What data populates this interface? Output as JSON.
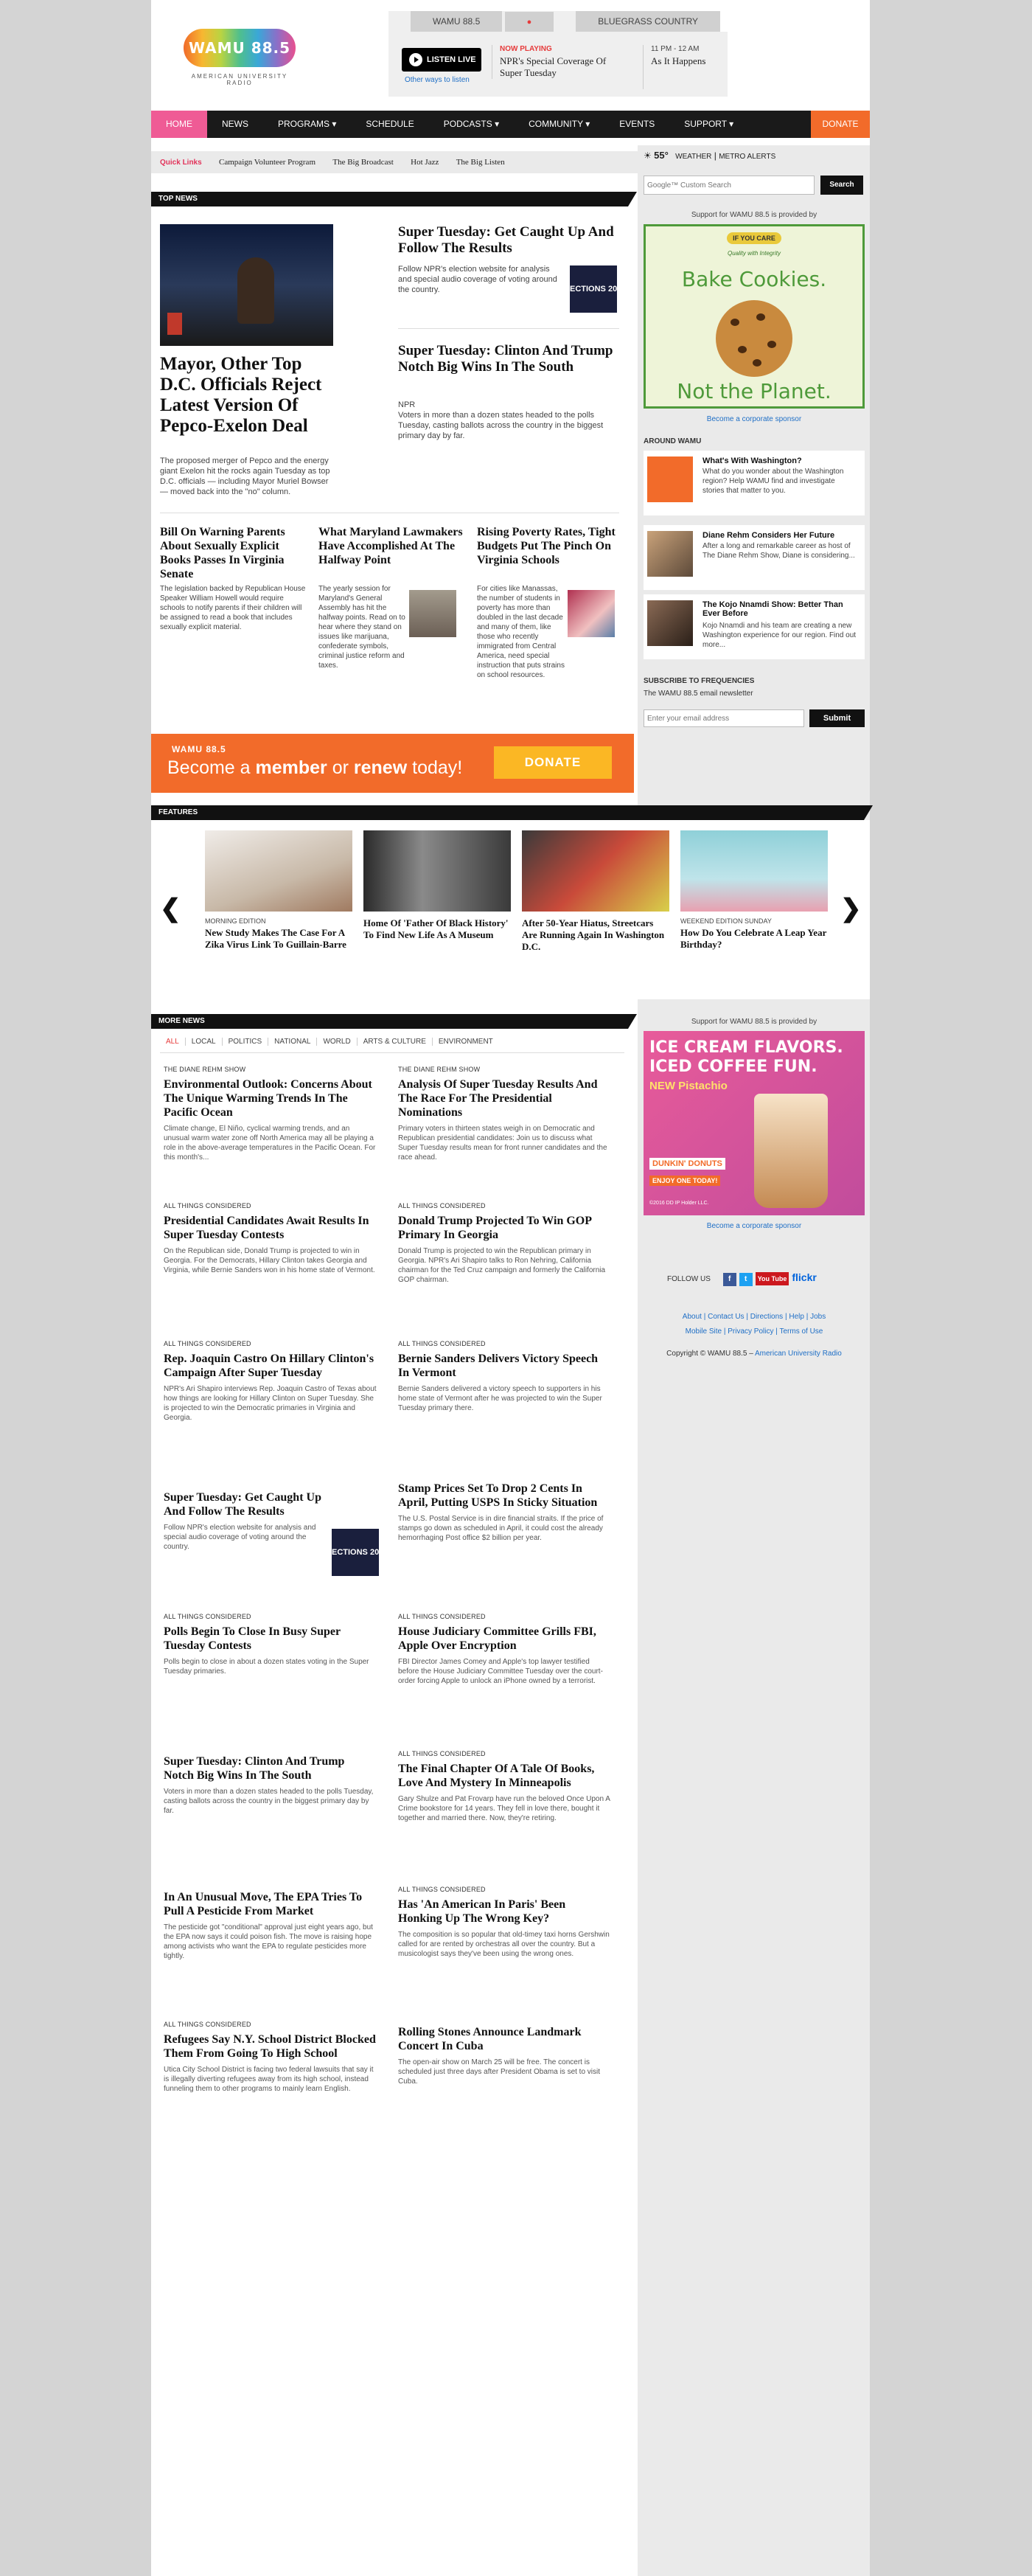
{
  "header": {
    "logo_text": "WAMU 88.5",
    "logo_sub": "AMERICAN UNIVERSITY RADIO",
    "tabs": [
      {
        "label": "WAMU 88.5",
        "dot": "●"
      },
      {
        "label": "BLUEGRASS COUNTRY"
      }
    ],
    "listen_label": "LISTEN LIVE",
    "other_ways": "Other ways to listen",
    "now_playing_label": "NOW PLAYING",
    "now_playing_title": "NPR's Special Coverage Of Super Tuesday",
    "next_time": "11 PM - 12 AM",
    "next_title": "As It Happens"
  },
  "nav": [
    "HOME",
    "NEWS",
    "PROGRAMS ▾",
    "SCHEDULE",
    "PODCASTS ▾",
    "COMMUNITY ▾",
    "EVENTS",
    "SUPPORT ▾",
    "DONATE"
  ],
  "quick_links": {
    "label": "Quick Links",
    "items": [
      "Campaign Volunteer Program",
      "The Big Broadcast",
      "Hot Jazz",
      "The Big Listen"
    ]
  },
  "weather": {
    "temp": "55°",
    "weather_label": "WEATHER",
    "metro_label": "METRO ALERTS",
    "search_placeholder": "Google™ Custom Search",
    "search_button": "Search"
  },
  "support_text": "Support for WAMU 88.5 is provided by",
  "ad1": {
    "top": "IF YOU CARE",
    "sub": "Quality with Integrity",
    "line1": "Bake Cookies.",
    "line2": "Not the Planet."
  },
  "corporate_sponsor": "Become a corporate sponsor",
  "around": {
    "header": "AROUND WAMU",
    "items": [
      {
        "title": "What's With Washington?",
        "desc": "What do you wonder about the Washington region? Help WAMU find and investigate stories that matter to you."
      },
      {
        "title": "Diane Rehm Considers Her Future",
        "desc": "After a long and remarkable career as host of The Diane Rehm Show, Diane is considering..."
      },
      {
        "title": "The Kojo Nnamdi Show: Better Than Ever Before",
        "desc": "Kojo Nnamdi and his team are creating a new Washington experience for our region. Find out more..."
      }
    ]
  },
  "subscribe": {
    "header": "SUBSCRIBE TO FREQUENCIES",
    "sub": "The WAMU 88.5 email newsletter",
    "placeholder": "Enter your email address",
    "button": "Submit"
  },
  "top_news": {
    "label": "TOP NEWS",
    "lead": {
      "title": "Mayor, Other Top D.C. Officials Reject Latest Version Of Pepco-Exelon Deal",
      "desc": "The proposed merger of Pepco and the energy giant Exelon hit the rocks again Tuesday as top D.C. officials — including Mayor Muriel Bowser — moved back into the \"no\" column."
    },
    "right1": {
      "title": "Super Tuesday: Get Caught Up And Follow The Results",
      "desc": "Follow NPR's election website for analysis and special audio coverage of voting around the country.",
      "thumb": "ECTIONS 20"
    },
    "right2": {
      "title": "Super Tuesday: Clinton And Trump Notch Big Wins In The South",
      "source": "NPR",
      "desc": "Voters in more than a dozen states headed to the polls Tuesday, casting ballots across the country in the biggest primary day by far."
    },
    "bottom": [
      {
        "title": "Bill On Warning Parents About Sexually Explicit Books Passes In Virginia Senate",
        "desc": "The legislation backed by Republican House Speaker William Howell would require schools to notify parents if their children will be assigned to read a book that includes sexually explicit material."
      },
      {
        "title": "What Maryland Lawmakers Have Accomplished At The Halfway Point",
        "desc": "The yearly session for Maryland's General Assembly has hit the halfway points. Read on to hear where they stand on issues like marijuana, confederate symbols, criminal justice reform and taxes."
      },
      {
        "title": "Rising Poverty Rates, Tight Budgets Put The Pinch On Virginia Schools",
        "desc": "For cities like Manassas, the number of students in poverty has more than doubled in the last decade and many of them, like those who recently immigrated from Central America, need special instruction that puts strains on school resources."
      }
    ]
  },
  "banner": {
    "logo": "WAMU 88.5",
    "text_pre": "Become a ",
    "member": "member",
    "or": " or ",
    "renew": "renew",
    "text_post": " today!",
    "button": "DONATE"
  },
  "features": {
    "label": "FEATURES",
    "items": [
      {
        "label": "MORNING EDITION",
        "title": "New Study Makes The Case For A Zika Virus Link To Guillain-Barre"
      },
      {
        "label": "",
        "title": "Home Of 'Father Of Black History' To Find New Life As A Museum"
      },
      {
        "label": "",
        "title": "After 50-Year Hiatus, Streetcars Are Running Again In Washington D.C."
      },
      {
        "label": "WEEKEND EDITION SUNDAY",
        "title": "How Do You Celebrate A Leap Year Birthday?"
      }
    ]
  },
  "more_news": {
    "label": "MORE NEWS",
    "filters": [
      "ALL",
      "LOCAL",
      "POLITICS",
      "NATIONAL",
      "WORLD",
      "ARTS & CULTURE",
      "ENVIRONMENT"
    ],
    "items": [
      {
        "label": "THE DIANE REHM SHOW",
        "title": "Environmental Outlook: Concerns About The Unique Warming Trends In The Pacific Ocean",
        "desc": "Climate change, El Niño, cyclical warming trends, and an unusual warm water zone off North America may all be playing a role in the above-average temperatures in the Pacific Ocean. For this month's..."
      },
      {
        "label": "THE DIANE REHM SHOW",
        "title": "Analysis Of Super Tuesday Results And The Race For The Presidential Nominations",
        "desc": "Primary voters in thirteen states weigh in on Democratic and Republican presidential candidates: Join us to discuss what Super Tuesday results mean for front runner candidates and the race ahead."
      },
      {
        "label": "ALL THINGS CONSIDERED",
        "title": "Presidential Candidates Await Results In Super Tuesday Contests",
        "desc": "On the Republican side, Donald Trump is projected to win in Georgia. For the Democrats, Hillary Clinton takes Georgia and Virginia, while Bernie Sanders won in his home state of Vermont."
      },
      {
        "label": "ALL THINGS CONSIDERED",
        "title": "Donald Trump Projected To Win GOP Primary In Georgia",
        "desc": "Donald Trump is projected to win the Republican primary in Georgia. NPR's Ari Shapiro talks to Ron Nehring, California chairman for the Ted Cruz campaign and formerly the California GOP chairman."
      },
      {
        "label": "ALL THINGS CONSIDERED",
        "title": "Rep. Joaquin Castro On Hillary Clinton's Campaign After Super Tuesday",
        "desc": "NPR's Ari Shapiro interviews Rep. Joaquin Castro of Texas about how things are looking for Hillary Clinton on Super Tuesday. She is projected to win the Democratic primaries in Virginia and Georgia."
      },
      {
        "label": "ALL THINGS CONSIDERED",
        "title": "Bernie Sanders Delivers Victory Speech In Vermont",
        "desc": "Bernie Sanders delivered a victory speech to supporters in his home state of Vermont after he was projected to win the Super Tuesday primary there."
      },
      {
        "label": "",
        "title": "Super Tuesday: Get Caught Up And Follow The Results",
        "desc": "Follow NPR's election website for analysis and special audio coverage of voting around the country.",
        "thumb": "ECTIONS 20"
      },
      {
        "label": "",
        "title": "Stamp Prices Set To Drop 2 Cents In April, Putting USPS In Sticky Situation",
        "desc": "The U.S. Postal Service is in dire financial straits. If the price of stamps go down as scheduled in April, it could cost the already hemorrhaging Post office $2 billion per year."
      },
      {
        "label": "ALL THINGS CONSIDERED",
        "title": "Polls Begin To Close In Busy Super Tuesday Contests",
        "desc": "Polls begin to close in about a dozen states voting in the Super Tuesday primaries."
      },
      {
        "label": "ALL THINGS CONSIDERED",
        "title": "House Judiciary Committee Grills FBI, Apple Over Encryption",
        "desc": "FBI Director James Comey and Apple's top lawyer testified before the House Judiciary Committee Tuesday over the court-order forcing Apple to unlock an iPhone owned by a terrorist."
      },
      {
        "label": "",
        "title": "Super Tuesday: Clinton And Trump Notch Big Wins In The South",
        "desc": "Voters in more than a dozen states headed to the polls Tuesday, casting ballots across the country in the biggest primary day by far."
      },
      {
        "label": "ALL THINGS CONSIDERED",
        "title": "The Final Chapter Of A Tale Of Books, Love And Mystery In Minneapolis",
        "desc": "Gary Shulze and Pat Frovarp have run the beloved Once Upon A Crime bookstore for 14 years. They fell in love there, bought it together and married there. Now, they're retiring."
      },
      {
        "label": "",
        "title": "In An Unusual Move, The EPA Tries To Pull A Pesticide From Market",
        "desc": "The pesticide got \"conditional\" approval just eight years ago, but the EPA now says it could poison fish. The move is raising hope among activists who want the EPA to regulate pesticides more tightly."
      },
      {
        "label": "ALL THINGS CONSIDERED",
        "title": "Has 'An American In Paris' Been Honking Up The Wrong Key?",
        "desc": "The composition is so popular that old-timey taxi horns Gershwin called for are rented by orchestras all over the country. But a musicologist says they've been using the wrong ones."
      },
      {
        "label": "ALL THINGS CONSIDERED",
        "title": "Refugees Say N.Y. School District Blocked Them From Going To High School",
        "desc": "Utica City School District is facing two federal lawsuits that say it is illegally diverting refugees away from its high school, instead funneling them to other programs to mainly learn English."
      },
      {
        "label": "",
        "title": "Rolling Stones Announce Landmark Concert In Cuba",
        "desc": "The open-air show on March 25 will be free. The concert is scheduled just three days after President Obama is set to visit Cuba."
      }
    ]
  },
  "ad2": {
    "line1": "ICE CREAM FLAVORS.",
    "line2": "ICED COFFEE FUN.",
    "line3": "NEW Pistachio",
    "brand": "DUNKIN' DONUTS",
    "cta": "ENJOY ONE TODAY!",
    "fine": "©2016 DD IP Holder LLC."
  },
  "footer": {
    "follow": "FOLLOW US",
    "social": [
      "f",
      "t",
      "You Tube",
      "flickr"
    ],
    "links1": [
      "About",
      "Contact Us",
      "Directions",
      "Help",
      "Jobs"
    ],
    "links2": [
      "Mobile Site",
      "Privacy Policy",
      "Terms of Use"
    ],
    "copyright": "Copyright © WAMU 88.5 –",
    "copyright_link": "American University Radio"
  },
  "colors": {
    "brand_pink": "#ef5b95",
    "donate_orange": "#f26b2a",
    "link_blue": "#1f6fc6",
    "alert_red": "#e63b3b"
  }
}
